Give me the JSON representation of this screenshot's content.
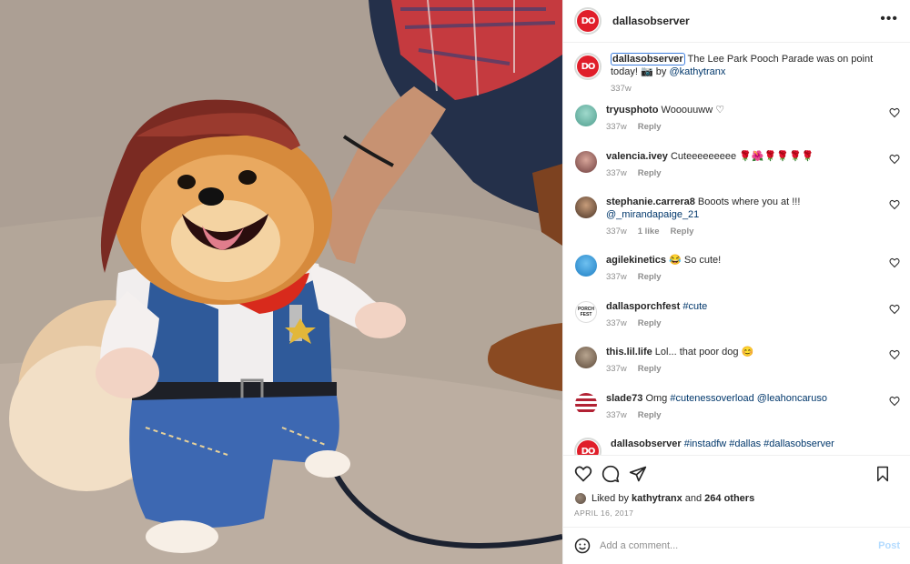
{
  "post": {
    "username": "dallasobserver",
    "avatar_text": "DO",
    "more_glyph": "•••",
    "caption": {
      "username": "dallasobserver",
      "text": " The Lee Park Pooch Parade was on point today! 📷 by ",
      "mention": "@kathytranx",
      "age": "337w"
    }
  },
  "comments": [
    {
      "username": "tryusphoto",
      "text": "Wooouuww ♡",
      "age": "337w",
      "likes": "",
      "reply": "Reply",
      "avatar_color": "#6bb7a8"
    },
    {
      "username": "valencia.ivey",
      "text": "Cuteeeeeeeee 🌹🌺🌹🌹🌹🌹",
      "age": "337w",
      "likes": "",
      "reply": "Reply",
      "avatar_color": "#b07a7a"
    },
    {
      "username": "stephanie.carrera8",
      "text": "Booots where you at !!! ",
      "mention": "@_mirandapaige_21",
      "age": "337w",
      "likes": "1 like",
      "reply": "Reply",
      "avatar_color": "#6e5443"
    },
    {
      "username": "agilekinetics",
      "text": "😂 So cute!",
      "age": "337w",
      "likes": "",
      "reply": "Reply",
      "avatar_color": "#3a9ad9"
    },
    {
      "username": "dallasporchfest",
      "text": "",
      "mention": "#cute",
      "age": "337w",
      "likes": "",
      "reply": "Reply",
      "avatar_color": "#ffffff"
    },
    {
      "username": "this.lil.life",
      "text": "Lol... that poor dog 😊",
      "age": "337w",
      "likes": "",
      "reply": "Reply",
      "avatar_color": "#7a6a5a"
    },
    {
      "username": "slade73",
      "text": "Omg ",
      "mention": "#cutenessoverload @leahoncaruso",
      "age": "337w",
      "likes": "",
      "reply": "Reply",
      "avatar_color": "#b22234"
    },
    {
      "username": "dallasobserver",
      "text": "",
      "mention": "#instadfw #dallas #dallasobserver",
      "age": "",
      "likes": "",
      "reply": "",
      "avatar_color": "#e01e2a"
    }
  ],
  "porchfest_avatar_text": "PORCH FEST",
  "actions": {
    "liked_prefix": "Liked by ",
    "liked_user": "kathytranx",
    "liked_and": " and ",
    "liked_others": "264 others",
    "date": "APRIL 16, 2017"
  },
  "add_comment": {
    "placeholder": "Add a comment...",
    "post_label": "Post"
  },
  "colors": {
    "brand_red": "#e01e2a",
    "link": "#00376b",
    "muted": "#8e8e8e",
    "post_disabled": "#b3dbff"
  },
  "icons": [
    "heart-icon",
    "comment-icon",
    "share-icon",
    "bookmark-icon",
    "emoji-icon",
    "more-icon"
  ]
}
